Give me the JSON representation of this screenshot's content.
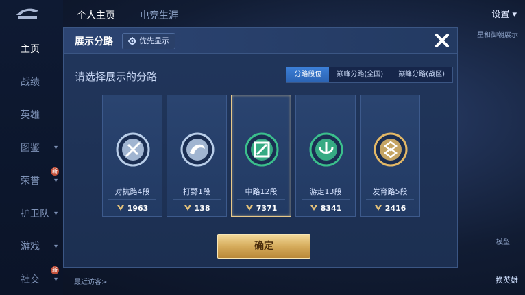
{
  "background": {
    "sidebar_items": [
      {
        "label": "主页",
        "active": true
      },
      {
        "label": "战绩"
      },
      {
        "label": "英雄"
      },
      {
        "label": "图鉴",
        "chevron": true
      },
      {
        "label": "荣誉",
        "chevron": true,
        "badge": "新"
      },
      {
        "label": "护卫队",
        "chevron": true
      },
      {
        "label": "游戏",
        "chevron": true
      },
      {
        "label": "社交",
        "chevron": true,
        "badge": "新"
      }
    ],
    "top_tabs": [
      {
        "label": "个人主页",
        "active": true
      },
      {
        "label": "电竞生涯"
      }
    ],
    "settings_label": "设置",
    "side_text": "星和御朝展示",
    "model_text": "模型",
    "swap_text": "换英雄",
    "visitor_text": "最近访客>"
  },
  "modal": {
    "title": "展示分路",
    "priority_button": "优先显示",
    "subtitle": "请选择展示的分路",
    "segments": [
      {
        "label": "分路段位",
        "active": true
      },
      {
        "label": "巅峰分路(全国)"
      },
      {
        "label": "巅峰分路(战区)"
      }
    ],
    "cards": [
      {
        "label": "对抗路4段",
        "points": "1963",
        "icon": "clash-lane-icon",
        "color": "#b8cde8",
        "selected": false
      },
      {
        "label": "打野1段",
        "points": "138",
        "icon": "jungle-icon",
        "color": "#b8cde8",
        "selected": false
      },
      {
        "label": "中路12段",
        "points": "7371",
        "icon": "mid-lane-icon",
        "color": "#3bbf8c",
        "selected": true
      },
      {
        "label": "游走13段",
        "points": "8341",
        "icon": "roam-icon",
        "color": "#3bbf8c",
        "selected": false
      },
      {
        "label": "发育路5段",
        "points": "2416",
        "icon": "farm-lane-icon",
        "color": "#e3b866",
        "selected": false
      }
    ],
    "confirm_button": "确定"
  },
  "colors": {
    "accent_blue": "#2b63b3",
    "gold": "#d6ac5c",
    "selected_border": "#e8c98a"
  }
}
